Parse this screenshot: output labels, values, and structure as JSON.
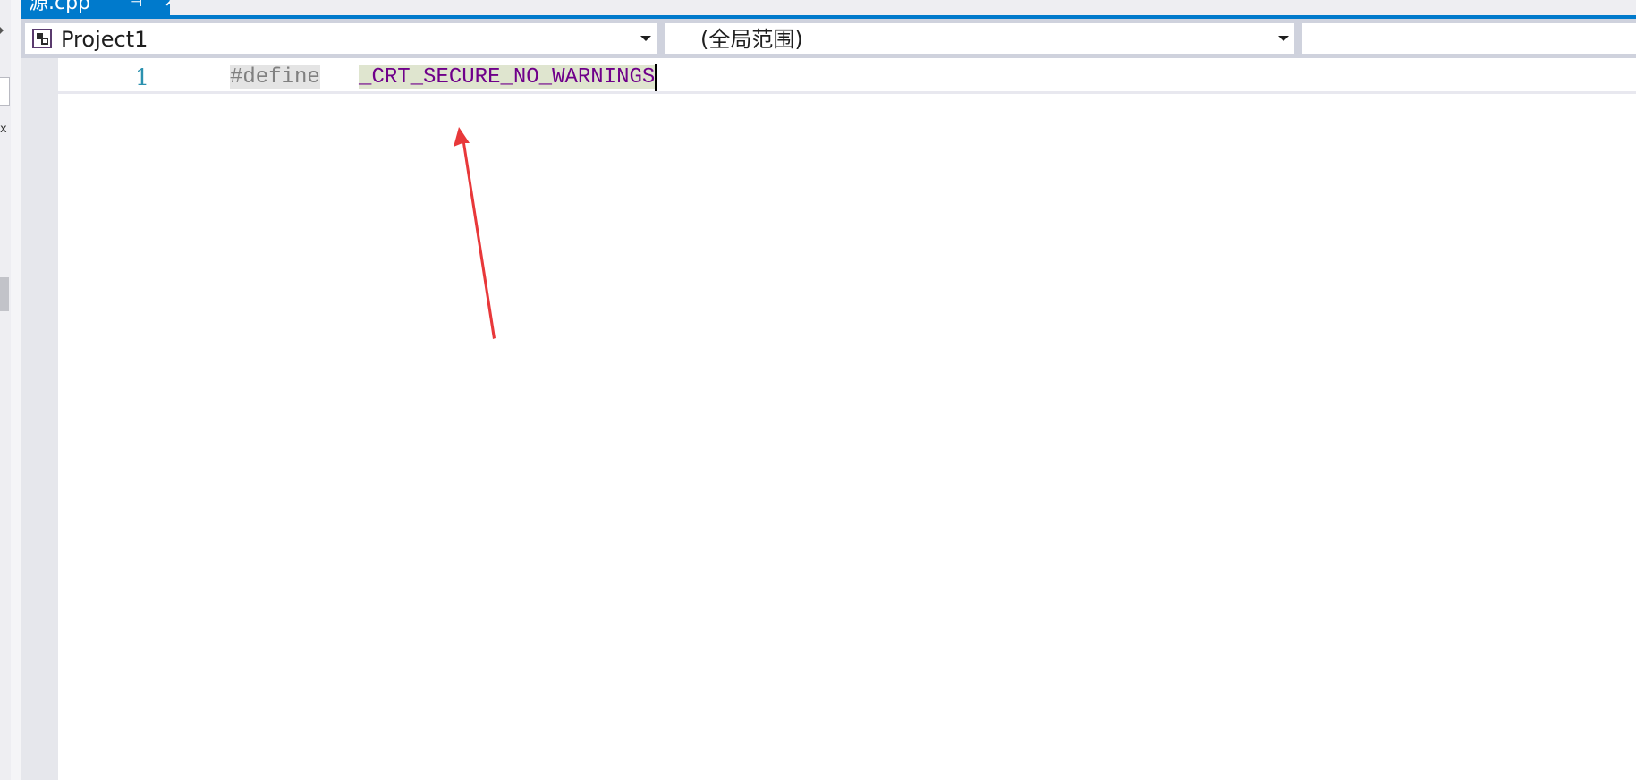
{
  "tab": {
    "title": "源.cpp",
    "pin_glyph": "⊣",
    "close_glyph": "✕"
  },
  "nav": {
    "project": "Project1",
    "scope": "(全局范围)",
    "member": ""
  },
  "editor": {
    "line_number": "1",
    "code": {
      "keyword": "#define",
      "spacing": "   ",
      "macro": "_CRT_SECURE_NO_WARNINGS"
    }
  },
  "side_panel": {
    "glyph": "x"
  },
  "icons": [
    "project-icon",
    "dropdown-arrow-icon",
    "pin-icon",
    "close-icon"
  ],
  "colors": {
    "accent": "#007acc",
    "line_number": "#2b91af",
    "preprocessor": "#808080",
    "macro": "#6f008a",
    "annotation_arrow": "#e8383a"
  }
}
